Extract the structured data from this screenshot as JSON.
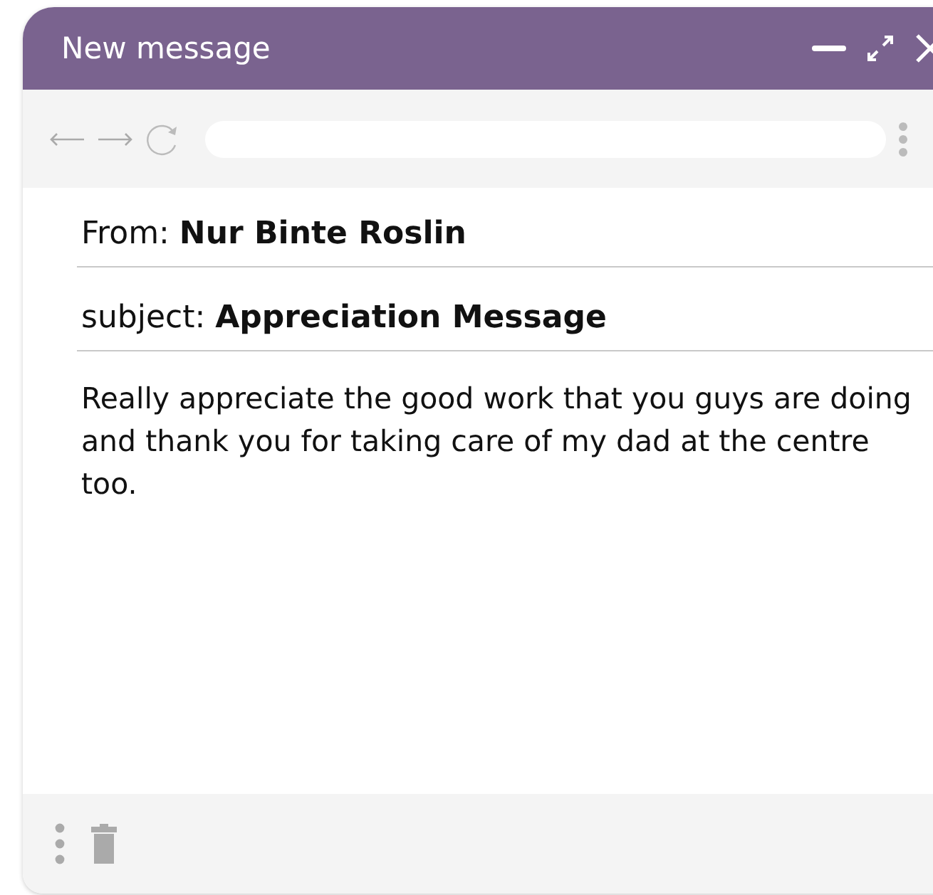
{
  "window": {
    "title": "New message"
  },
  "from": {
    "label": "From:",
    "value": "Nur Binte Roslin"
  },
  "subject": {
    "label": "subject:",
    "value": "Appreciation Message"
  },
  "message": "Really appreciate the good work that you guys are doing and thank you for taking care of my dad at the centre too."
}
